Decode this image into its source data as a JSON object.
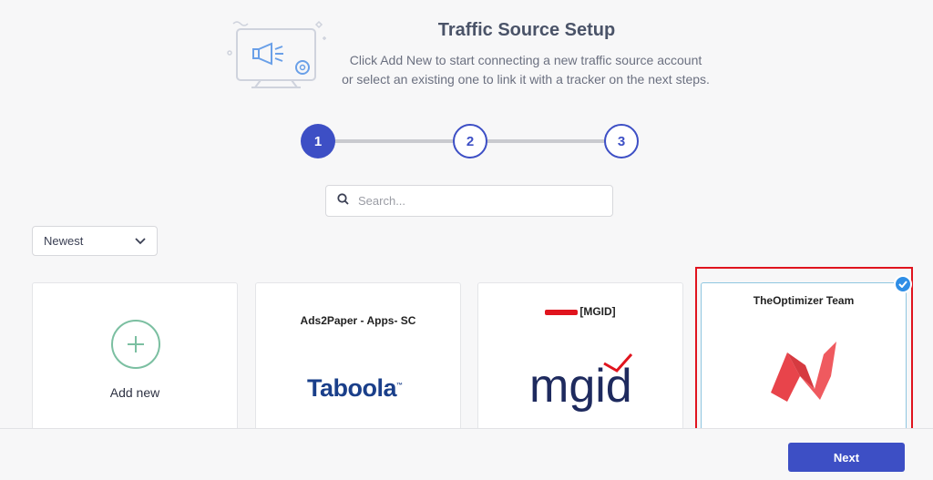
{
  "header": {
    "title": "Traffic Source Setup",
    "subtitle_line1": "Click Add New to start connecting a new traffic source account",
    "subtitle_line2": "or select an existing one to link it with a tracker on the next steps."
  },
  "stepper": {
    "steps": [
      "1",
      "2",
      "3"
    ],
    "active_step": 1
  },
  "search": {
    "placeholder": "Search..."
  },
  "sort": {
    "selected": "Newest"
  },
  "cards": {
    "add_new": {
      "label": "Add new"
    },
    "items": [
      {
        "title": "Ads2Paper - Apps- SC",
        "logo": "Taboola",
        "logo_tm": "™"
      },
      {
        "title": "[MGID]",
        "logo": "mgid"
      },
      {
        "title": "TheOptimizer Team",
        "logo": "theoptimizer-logo",
        "selected": true
      }
    ]
  },
  "footer": {
    "next_label": "Next"
  },
  "colors": {
    "primary": "#3d4fc5",
    "add_green": "#7bbfa1",
    "selected_red": "#e0141e",
    "check_blue": "#2f8ee6"
  }
}
